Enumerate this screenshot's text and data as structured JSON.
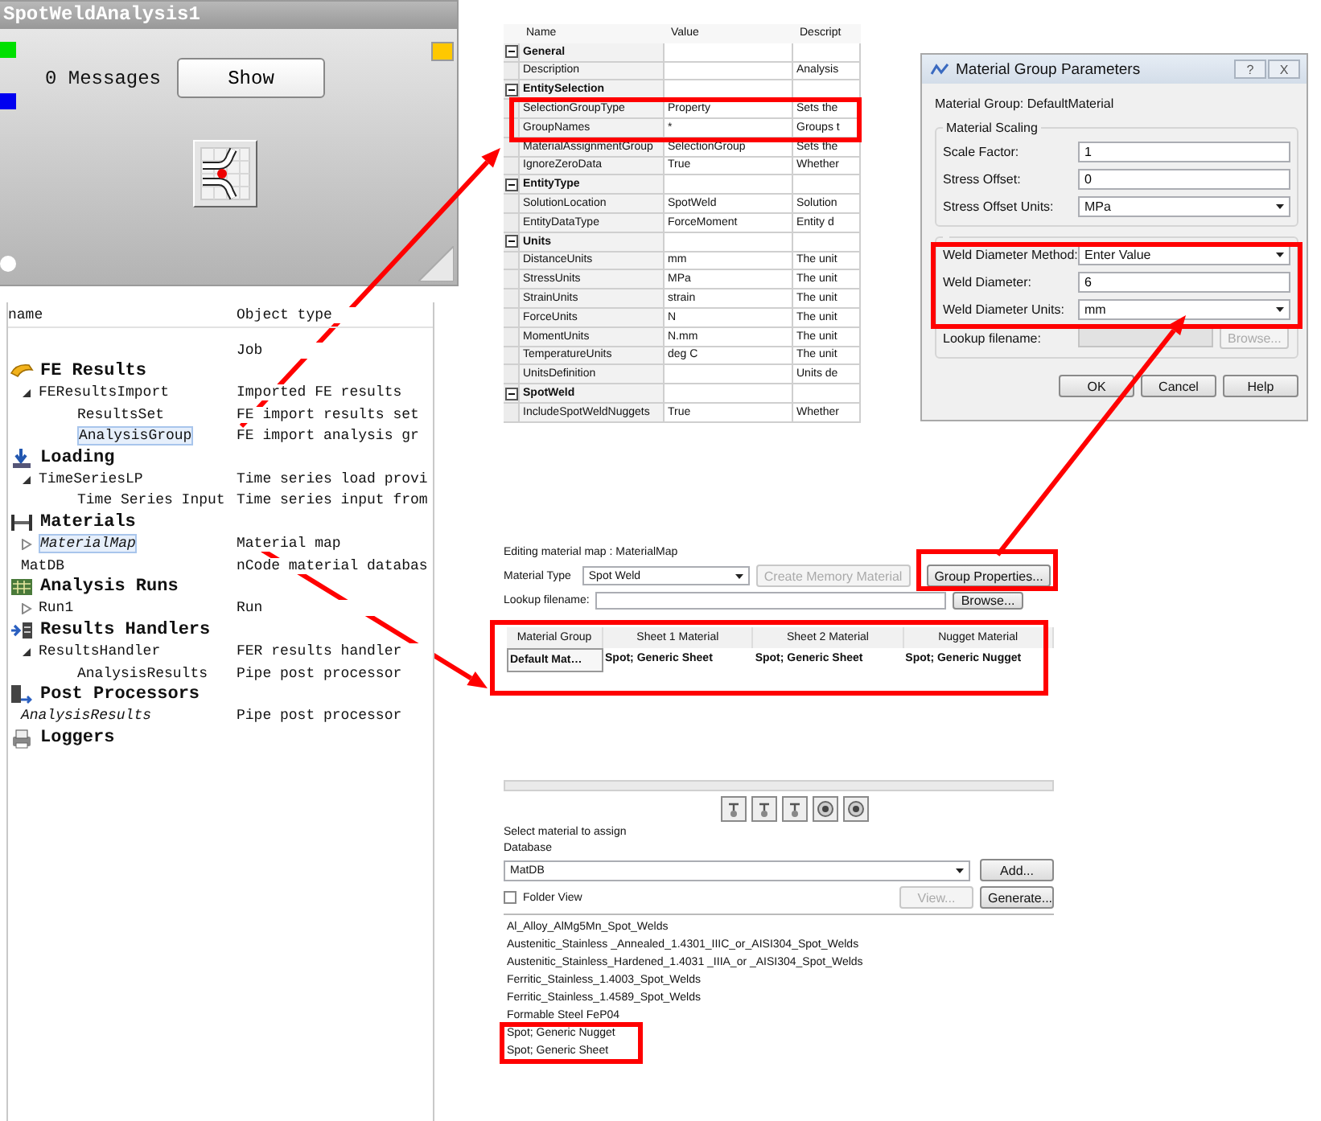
{
  "node": {
    "title": "SpotWeldAnalysis1",
    "messages": "0 Messages",
    "show_button": "Show"
  },
  "tree": {
    "columns": [
      "name",
      "Object type"
    ],
    "rows": [
      {
        "kind": "job",
        "type": "Job"
      },
      {
        "kind": "category",
        "name": "FE Results",
        "children": [
          {
            "name": "FEResultsImport",
            "type": "Imported FE results",
            "expanded": true,
            "selected": false,
            "italic": false,
            "children": [
              {
                "name": "ResultsSet",
                "type": "FE import results set",
                "selected": false,
                "italic": false
              },
              {
                "name": "AnalysisGroup",
                "type": "FE import analysis gr",
                "selected": true,
                "italic": false
              }
            ]
          }
        ]
      },
      {
        "kind": "category",
        "name": "Loading",
        "children": [
          {
            "name": "TimeSeriesLP",
            "type": "Time series load provi",
            "expanded": true,
            "selected": false,
            "italic": false,
            "children": [
              {
                "name": "Time Series Input",
                "type": "Time series input from",
                "selected": false,
                "italic": false
              }
            ]
          }
        ]
      },
      {
        "kind": "category",
        "name": "Materials",
        "children": [
          {
            "name": "MaterialMap",
            "type": "Material map",
            "expanded": false,
            "selected": true,
            "italic": true
          },
          {
            "name": "MatDB",
            "type": "nCode material databas",
            "selected": false,
            "italic": false
          }
        ]
      },
      {
        "kind": "category",
        "name": "Analysis Runs",
        "children": [
          {
            "name": "Run1",
            "type": "Run",
            "expanded": false,
            "selected": false,
            "italic": false
          }
        ]
      },
      {
        "kind": "category",
        "name": "Results Handlers",
        "children": [
          {
            "name": "ResultsHandler",
            "type": "FER results handler",
            "expanded": true,
            "selected": false,
            "italic": false,
            "children": [
              {
                "name": "AnalysisResults",
                "type": "Pipe post processor",
                "selected": false,
                "italic": false
              }
            ]
          }
        ]
      },
      {
        "kind": "category",
        "name": "Post Processors",
        "children": [
          {
            "name": "AnalysisResults",
            "type": "Pipe post processor",
            "selected": false,
            "italic": true
          }
        ]
      },
      {
        "kind": "category",
        "name": "Loggers"
      }
    ]
  },
  "properties": {
    "columns": [
      "Name",
      "Value",
      "Descript"
    ],
    "groups": [
      {
        "name": "General",
        "expanded": true,
        "rows": [
          {
            "name": "Description",
            "description": "Analysis"
          }
        ]
      },
      {
        "name": "EntitySelection",
        "expanded": true,
        "rows": [
          {
            "name": "SelectionGroupType",
            "value": "Property",
            "description": "Sets the"
          },
          {
            "name": "GroupNames",
            "value": "*",
            "description": "Groups t"
          },
          {
            "name": "MaterialAssignmentGroup",
            "value": "SelectionGroup",
            "description": "Sets the"
          },
          {
            "name": "IgnoreZeroData",
            "value": "True",
            "description": "Whether"
          }
        ]
      },
      {
        "name": "EntityType",
        "expanded": true,
        "rows": [
          {
            "name": "SolutionLocation",
            "value": "SpotWeld",
            "description": "Solution"
          },
          {
            "name": "EntityDataType",
            "value": "ForceMoment",
            "description": "Entity d"
          }
        ]
      },
      {
        "name": "Units",
        "expanded": true,
        "rows": [
          {
            "name": "DistanceUnits",
            "value": "mm",
            "description": "The unit"
          },
          {
            "name": "StressUnits",
            "value": "MPa",
            "description": "The unit"
          },
          {
            "name": "StrainUnits",
            "value": "strain",
            "description": "The unit"
          },
          {
            "name": "ForceUnits",
            "value": "N",
            "description": "The unit"
          },
          {
            "name": "MomentUnits",
            "value": "N.mm",
            "description": "The unit"
          },
          {
            "name": "TemperatureUnits",
            "value": "deg C",
            "description": "The unit"
          },
          {
            "name": "UnitsDefinition",
            "description": "Units de"
          }
        ]
      },
      {
        "name": "SpotWeld",
        "expanded": true,
        "rows": [
          {
            "name": "IncludeSpotWeldNuggets",
            "value": "True",
            "description": "Whether"
          }
        ]
      }
    ]
  },
  "dialog": {
    "title": "Material Group Parameters",
    "title_buttons": [
      "?",
      "X"
    ],
    "group_label": "Material Group: DefaultMaterial",
    "sections": [
      {
        "title": "Material Scaling",
        "fields": [
          {
            "kind": "text",
            "label": "Scale Factor:",
            "value": "1"
          },
          {
            "kind": "text",
            "label": "Stress Offset:",
            "value": "0"
          },
          {
            "kind": "select",
            "label": "Stress Offset Units:",
            "value": "MPa"
          }
        ]
      },
      {
        "fields": [
          {
            "kind": "select",
            "label": "Weld Diameter Method:",
            "value": "Enter Value"
          },
          {
            "kind": "text",
            "label": "Weld Diameter:",
            "value": "6"
          },
          {
            "kind": "select",
            "label": "Weld Diameter Units:",
            "value": "mm"
          },
          {
            "kind": "file",
            "label": "Lookup filename:",
            "button": "Browse...",
            "disabled": true
          }
        ]
      }
    ],
    "buttons": [
      "OK",
      "Cancel",
      "Help"
    ]
  },
  "editor": {
    "heading": "Editing material map :  MaterialMap",
    "type_label": "Material Type",
    "type_value": "Spot Weld",
    "create_button": {
      "label": "Create Memory Material",
      "disabled": true
    },
    "group_button": {
      "label": "Group Properties...",
      "disabled": false
    },
    "lookup_label": "Lookup filename:",
    "browse_button": "Browse...",
    "columns": [
      "Material Group",
      "Sheet 1 Material",
      "Sheet 2 Material",
      "Nugget Material"
    ],
    "rows": [
      {
        "cells": [
          "Default Mat…",
          "Spot; Generic Sheet",
          "Spot; Generic Sheet",
          "Spot; Generic Nugget"
        ],
        "selected": true
      }
    ]
  },
  "assign": {
    "prompt": "Select material to assign",
    "database_label": "Database",
    "database": "MatDB",
    "add_button": "Add...",
    "folder_view": {
      "label": "Folder View",
      "checked": false
    },
    "view_button": {
      "label": "View...",
      "disabled": true
    },
    "generate_button": {
      "label": "Generate...",
      "disabled": false
    },
    "materials": [
      {
        "name": "Al_Alloy_AlMg5Mn_Spot_Welds",
        "selected": false
      },
      {
        "name": "Austenitic_Stainless _Annealed_1.4301_IIIC_or_AISI304_Spot_Welds",
        "selected": false
      },
      {
        "name": "Austenitic_Stainless_Hardened_1.4031 _IIIA_or _AISI304_Spot_Welds",
        "selected": false
      },
      {
        "name": "Ferritic_Stainless_1.4003_Spot_Welds",
        "selected": false
      },
      {
        "name": "Ferritic_Stainless_1.4589_Spot_Welds",
        "selected": false
      },
      {
        "name": "Formable Steel FeP04",
        "selected": false
      },
      {
        "name": "Spot; Generic Nugget",
        "selected": false
      },
      {
        "name": "Spot; Generic Sheet",
        "selected": false
      }
    ]
  }
}
